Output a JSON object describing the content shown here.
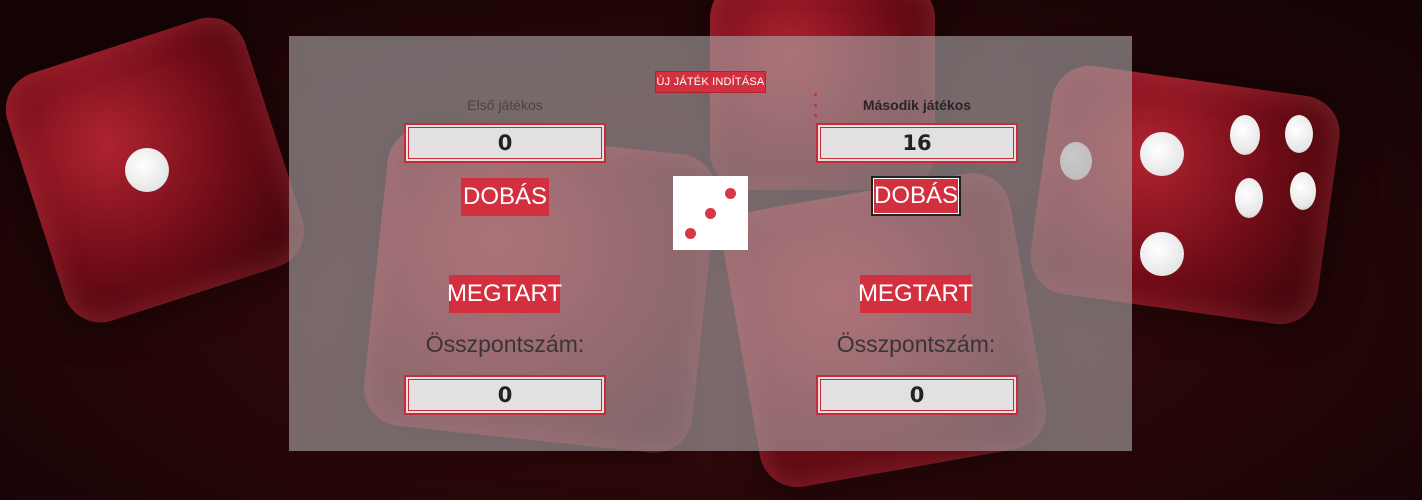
{
  "game": {
    "new_game_label": "ÚJ JÁTÉK INDÍTÁSA",
    "die_value": 3,
    "active_player": 2
  },
  "players": [
    {
      "label": "Első játékos",
      "current_score": "0",
      "roll_label": "DOBÁS",
      "hold_label": "MEGTART",
      "total_label": "Összpontszám:",
      "total_score": "0"
    },
    {
      "label": "Második játékos",
      "current_score": "16",
      "roll_label": "DOBÁS",
      "hold_label": "MEGTART",
      "total_label": "Összpontszám:",
      "total_score": "0"
    }
  ],
  "colors": {
    "accent": "#d3303f",
    "panel": "#aaa5a6",
    "background": "#2a0709"
  }
}
